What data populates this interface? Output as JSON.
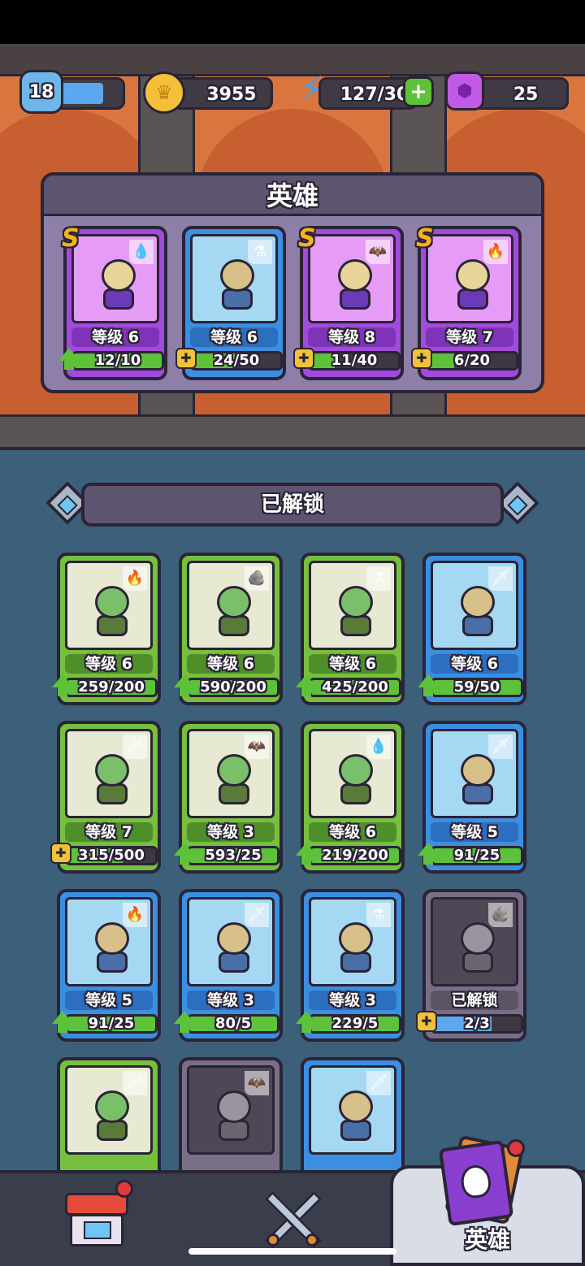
{
  "status": {
    "player_level": "18",
    "coins": "3955",
    "energy": "127/30",
    "gems": "25"
  },
  "hero_panel": {
    "title": "英雄",
    "cards": [
      {
        "rank": "S",
        "level": "等级 6",
        "progress": "12/10",
        "fill": 1.0,
        "color": "purple",
        "element": "💧",
        "icon": "arrow"
      },
      {
        "rank": "",
        "level": "等级 6",
        "progress": "24/50",
        "fill": 0.48,
        "color": "blue",
        "element": "⚗",
        "icon": "puzzle"
      },
      {
        "rank": "S",
        "level": "等级 8",
        "progress": "11/40",
        "fill": 0.275,
        "color": "purple",
        "element": "🦇",
        "icon": "puzzle"
      },
      {
        "rank": "S",
        "level": "等级 7",
        "progress": "6/20",
        "fill": 0.3,
        "color": "purple",
        "element": "🔥",
        "icon": "puzzle"
      }
    ]
  },
  "unlocked": {
    "title": "已解锁",
    "cards": [
      {
        "level": "等级 6",
        "progress": "259/200",
        "fill": 1.0,
        "color": "green",
        "element": "🔥",
        "icon": "arrow"
      },
      {
        "level": "等级 6",
        "progress": "590/200",
        "fill": 1.0,
        "color": "green",
        "element": "🪨",
        "icon": "arrow"
      },
      {
        "level": "等级 6",
        "progress": "425/200",
        "fill": 1.0,
        "color": "green",
        "element": "⚗",
        "icon": "arrow"
      },
      {
        "level": "等级 6",
        "progress": "59/50",
        "fill": 1.0,
        "color": "blue",
        "element": "🗡",
        "icon": "arrow"
      },
      {
        "level": "等级 7",
        "progress": "315/500",
        "fill": 0.63,
        "color": "green",
        "element": "🗡",
        "icon": "puzzle"
      },
      {
        "level": "等级 3",
        "progress": "593/25",
        "fill": 1.0,
        "color": "green",
        "element": "🦇",
        "icon": "arrow"
      },
      {
        "level": "等级 6",
        "progress": "219/200",
        "fill": 1.0,
        "color": "green",
        "element": "💧",
        "icon": "arrow"
      },
      {
        "level": "等级 5",
        "progress": "91/25",
        "fill": 1.0,
        "color": "blue",
        "element": "🗡",
        "icon": "arrow"
      },
      {
        "level": "等级 5",
        "progress": "91/25",
        "fill": 1.0,
        "color": "blue",
        "element": "🔥",
        "icon": "arrow"
      },
      {
        "level": "等级 3",
        "progress": "80/5",
        "fill": 1.0,
        "color": "blue",
        "element": "🗡",
        "icon": "arrow"
      },
      {
        "level": "等级 3",
        "progress": "229/5",
        "fill": 1.0,
        "color": "blue",
        "element": "⚗",
        "icon": "arrow"
      },
      {
        "level": "已解锁",
        "progress": "2/3",
        "fill": 0.67,
        "color": "gray",
        "element": "🪨",
        "icon": "puzzle"
      },
      {
        "level": "",
        "progress": "",
        "fill": 0,
        "color": "green",
        "element": "🗡",
        "icon": ""
      },
      {
        "level": "",
        "progress": "",
        "fill": 0,
        "color": "gray",
        "element": "🦇",
        "icon": ""
      },
      {
        "level": "",
        "progress": "",
        "fill": 0,
        "color": "blue",
        "element": "🗡",
        "icon": ""
      }
    ]
  },
  "nav": {
    "shop_icon": "shop-icon",
    "battle_icon": "crossed-swords-icon",
    "hero_label": "英雄"
  },
  "colors": {
    "green_card": "#77bf3e",
    "blue_card": "#3c8fe0",
    "purple_card": "#a04bdc",
    "gray_card": "#7a6e86",
    "progress_green": "#5ec13a"
  }
}
